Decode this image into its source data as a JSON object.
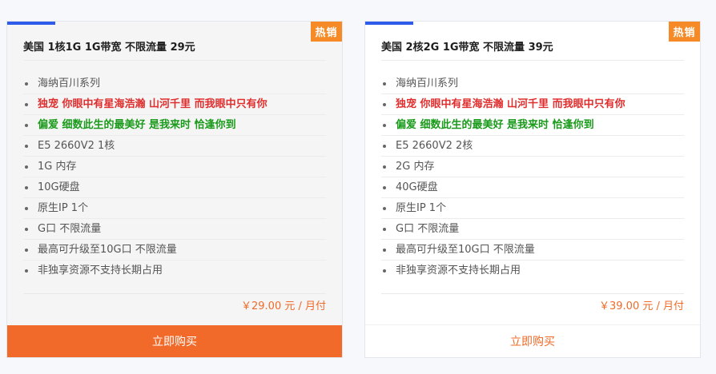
{
  "cards": [
    {
      "badge": "热销",
      "title": "美国 1核1G 1G带宽 不限流量 29元",
      "features": [
        {
          "text": "海纳百川系列",
          "style": "normal"
        },
        {
          "text": "独宠 你眼中有星海浩瀚 山河千里 而我眼中只有你",
          "style": "red"
        },
        {
          "text": "偏爱 细数此生的最美好 是我来时 恰逢你到",
          "style": "green"
        },
        {
          "text": "E5 2660V2 1核",
          "style": "normal"
        },
        {
          "text": "1G 内存",
          "style": "normal"
        },
        {
          "text": "10G硬盘",
          "style": "normal"
        },
        {
          "text": "原生IP 1个",
          "style": "normal"
        },
        {
          "text": "G口 不限流量",
          "style": "normal"
        },
        {
          "text": "最高可升级至10G口 不限流量",
          "style": "normal"
        },
        {
          "text": "非独享资源不支持长期占用",
          "style": "normal"
        }
      ],
      "price": "￥29.00 元 / 月付",
      "buy_label": "立即购买"
    },
    {
      "badge": "热销",
      "title": "美国 2核2G 1G带宽 不限流量 39元",
      "features": [
        {
          "text": "海纳百川系列",
          "style": "normal"
        },
        {
          "text": "独宠 你眼中有星海浩瀚 山河千里 而我眼中只有你",
          "style": "red"
        },
        {
          "text": "偏爱 细数此生的最美好 是我来时 恰逢你到",
          "style": "green"
        },
        {
          "text": "E5 2660V2 2核",
          "style": "normal"
        },
        {
          "text": "2G 内存",
          "style": "normal"
        },
        {
          "text": "40G硬盘",
          "style": "normal"
        },
        {
          "text": "原生IP 1个",
          "style": "normal"
        },
        {
          "text": "G口 不限流量",
          "style": "normal"
        },
        {
          "text": "最高可升级至10G口 不限流量",
          "style": "normal"
        },
        {
          "text": "非独享资源不支持长期占用",
          "style": "normal"
        }
      ],
      "price": "￥39.00 元 / 月付",
      "buy_label": "立即购买"
    }
  ],
  "colors": {
    "accent_bar": "#2f5bea",
    "badge": "#f68a26",
    "price": "#ef6b2a",
    "buy_active_bg": "#f26a2a",
    "highlight_red": "#e02e2e",
    "highlight_green": "#1a9a1a"
  },
  "icons": {
    "bullet": "bullet-dot-icon"
  }
}
